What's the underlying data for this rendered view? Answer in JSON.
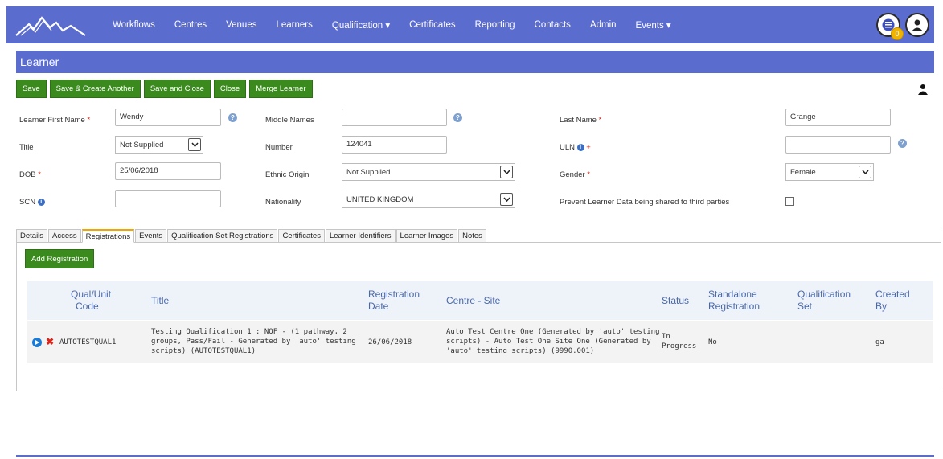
{
  "nav": {
    "items": [
      "Workflows",
      "Centres",
      "Venues",
      "Learners",
      "Qualification ▾",
      "Certificates",
      "Reporting",
      "Contacts",
      "Admin",
      "Events ▾"
    ],
    "notification_count": "0",
    "icons": [
      "logo-mountains",
      "list-icon",
      "user-icon"
    ]
  },
  "page": {
    "title": "Learner"
  },
  "toolbar": {
    "buttons": [
      "Save",
      "Save & Create Another",
      "Save and Close",
      "Close",
      "Merge Learner"
    ]
  },
  "form": {
    "first_name": {
      "label": "Learner First Name",
      "req": "*",
      "value": "Wendy"
    },
    "middle_names": {
      "label": "Middle Names",
      "value": ""
    },
    "last_name": {
      "label": "Last Name",
      "req": "*",
      "value": "Grange"
    },
    "title": {
      "label": "Title",
      "value": "Not Supplied"
    },
    "number": {
      "label": "Number",
      "value": "124041"
    },
    "uln": {
      "label": "ULN",
      "req": "+",
      "value": ""
    },
    "dob": {
      "label": "DOB",
      "req": "*",
      "value": "25/06/2018"
    },
    "ethnic_origin": {
      "label": "Ethnic Origin",
      "value": "Not Supplied"
    },
    "gender": {
      "label": "Gender",
      "req": "*",
      "value": "Female"
    },
    "scn": {
      "label": "SCN",
      "value": ""
    },
    "nationality": {
      "label": "Nationality",
      "value": "UNITED KINGDOM"
    },
    "prevent_sharing": {
      "label": "Prevent Learner Data being shared to third parties",
      "checked": false
    }
  },
  "tabs": [
    "Details",
    "Access",
    "Registrations",
    "Events",
    "Qualification Set Registrations",
    "Certificates",
    "Learner Identifiers",
    "Learner Images",
    "Notes"
  ],
  "active_tab": "Registrations",
  "registrations": {
    "add_label": "Add Registration",
    "columns": {
      "qual_code": [
        "Qual/Unit",
        "Code"
      ],
      "title": "Title",
      "reg_date": [
        "Registration",
        "Date"
      ],
      "centre_site": "Centre - Site",
      "status": "Status",
      "standalone": [
        "Standalone",
        "Registration"
      ],
      "qual_set": [
        "Qualification",
        "Set"
      ],
      "created_by": [
        "Created",
        "By"
      ]
    },
    "rows": [
      {
        "qual_code": "AUTOTESTQUAL1",
        "title_lines": [
          "Testing Qualification 1 : NQF - (1 pathway, 2",
          "groups, Pass/Fail - Generated by 'auto' testing",
          "scripts) (AUTOTESTQUAL1)"
        ],
        "reg_date": "26/06/2018",
        "centre_lines": [
          "Auto Test Centre One (Generated by 'auto' testing",
          "scripts) - Auto Test One Site One (Generated by",
          "'auto' testing scripts) (9990.001)"
        ],
        "status_lines": [
          "In",
          "Progress"
        ],
        "standalone": "No",
        "qual_set": "",
        "created_by": "ga"
      }
    ]
  },
  "colors": {
    "nav": "#5b6ccf",
    "button": "#3b8a1e",
    "required": "#d9261c",
    "header_text": "#4a68a8",
    "active_tab": "#f0a500"
  }
}
